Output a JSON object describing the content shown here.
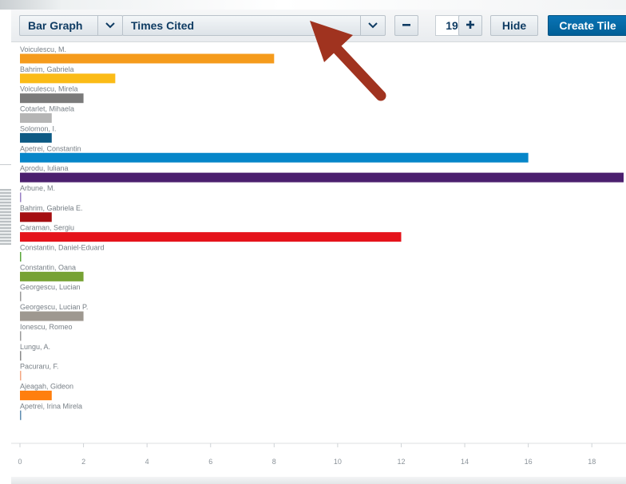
{
  "toolbar": {
    "view_select": {
      "value": "Bar Graph"
    },
    "metric_select": {
      "value": "Times Cited"
    },
    "count": {
      "value": "19"
    },
    "hide_label": "Hide",
    "create_tile_label": "Create Tile",
    "decrement_icon": "minus-icon",
    "increment_icon": "plus-icon",
    "dropdown_icon": "chevron-down-icon"
  },
  "annotation": {
    "arrow_icon": "arrow-up-left-icon",
    "color": "#a0331f"
  },
  "chart_data": {
    "type": "bar",
    "orientation": "horizontal",
    "categories": [
      "Voiculescu, M.",
      "Bahrim, Gabriela",
      "Voiculescu, Mirela",
      "Cotarlet, Mihaela",
      "Solomon, I.",
      "Apetrei, Constantin",
      "Aprodu, Iuliana",
      "Arbune, M.",
      "Bahrim, Gabriela E.",
      "Caraman, Sergiu",
      "Constantin, Daniel-Eduard",
      "Constantin, Oana",
      "Georgescu, Lucian",
      "Georgescu, Lucian P.",
      "Ionescu, Romeo",
      "Lungu, A.",
      "Pacuraru, F.",
      "Ajeagah, Gideon",
      "Apetrei, Irina Mirela"
    ],
    "values": [
      8,
      3,
      2,
      1,
      1,
      16,
      19,
      0,
      1,
      12,
      0,
      2,
      0,
      2,
      0,
      0,
      0,
      1,
      0
    ],
    "colors": [
      "#f59b1c",
      "#fbbb17",
      "#7a7a7a",
      "#b5b5b5",
      "#0d5a84",
      "#0686c9",
      "#4b1f6e",
      "#9a80c4",
      "#a50e11",
      "#e5131b",
      "#5aa63a",
      "#77a234",
      "#9a9a9a",
      "#9e9890",
      "#9b9b9b",
      "#8a8a8a",
      "#f4a782",
      "#ff7f0e",
      "#5f8db0"
    ],
    "xticks": [
      "0",
      "2",
      "4",
      "6",
      "8",
      "10",
      "12",
      "14",
      "16",
      "18"
    ],
    "xlim": [
      0,
      19
    ]
  }
}
